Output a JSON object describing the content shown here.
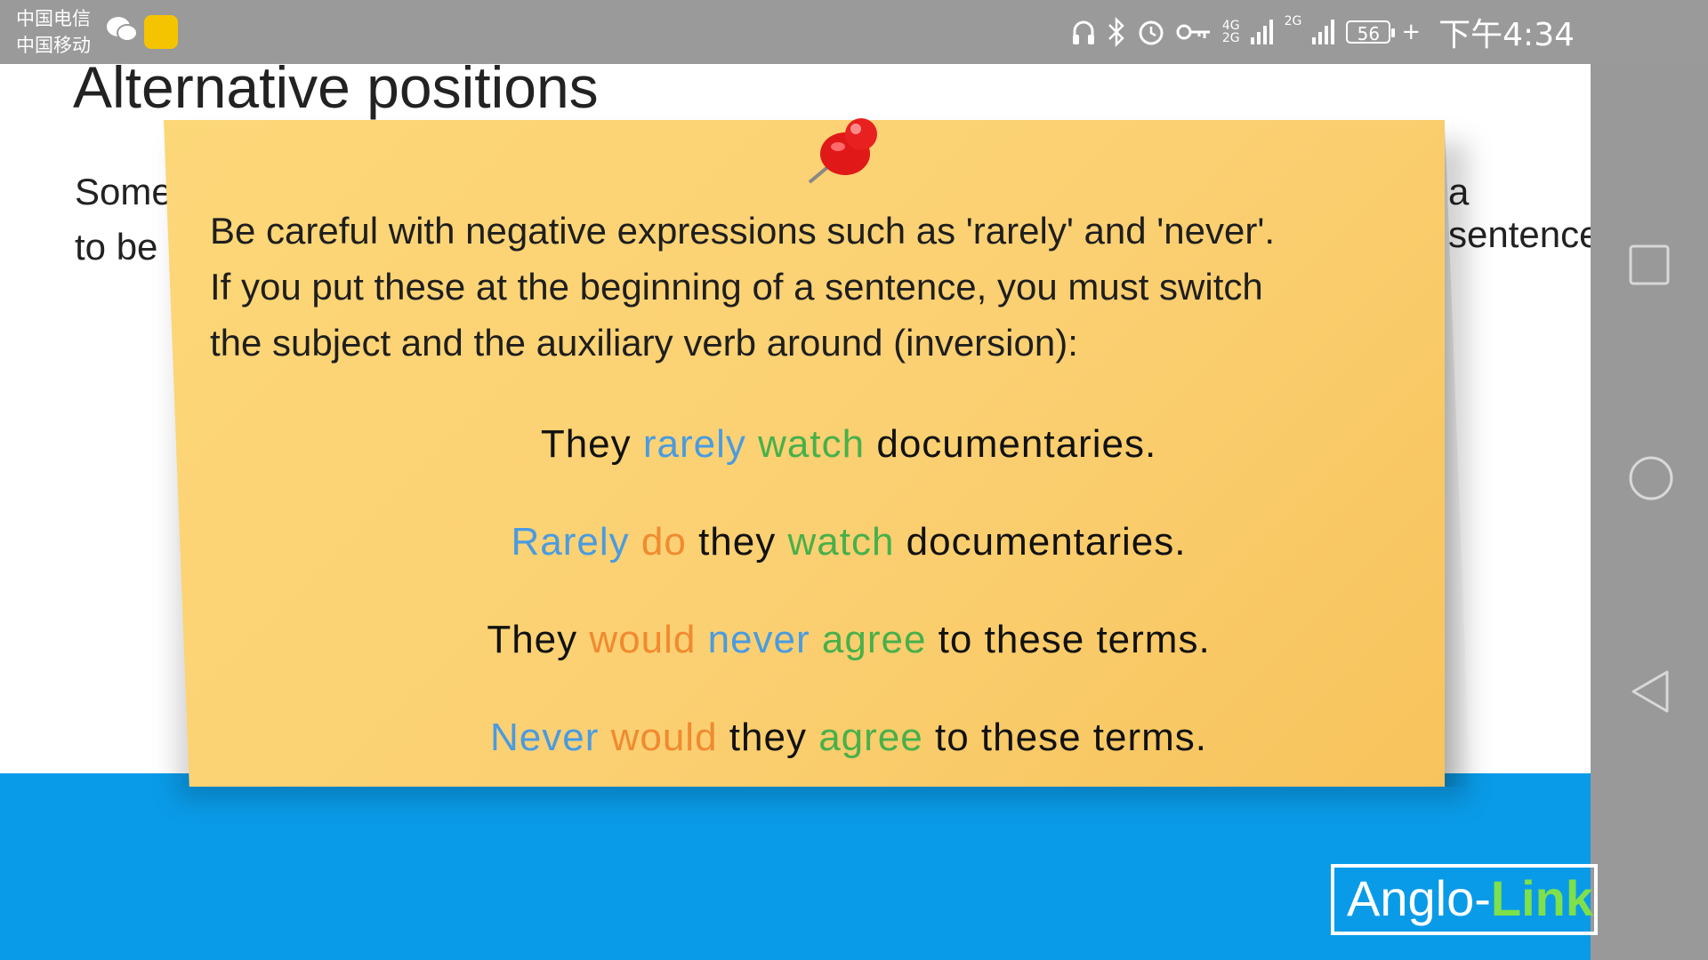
{
  "status_bar": {
    "carrier_1": "中国电信",
    "carrier_2": "中国移动",
    "network_1": "4G",
    "network_2": "2G",
    "network_3": "2G",
    "battery": "56",
    "time": "下午4:34",
    "icons": [
      "wechat-icon",
      "app-icon",
      "headphones-icon",
      "bluetooth-icon",
      "alarm-icon",
      "key-icon",
      "signal-icon",
      "signal-icon",
      "battery-icon",
      "charging-icon"
    ]
  },
  "slide": {
    "title": "Alternative positions",
    "bg_line1_left": "Some",
    "bg_line1_right": "a sentence",
    "bg_line2_left": "to be"
  },
  "note": {
    "line1": "Be careful with negative expressions such as 'rarely' and 'never'.",
    "line2": "If you put these at the beginning of a sentence, you must switch",
    "line3": "the subject and the auxiliary verb around (inversion):",
    "examples": [
      [
        {
          "text": "They",
          "color": "#111111"
        },
        {
          "text": "rarely",
          "color": "#4a9be0"
        },
        {
          "text": "watch",
          "color": "#48b04a"
        },
        {
          "text": "documentaries.",
          "color": "#111111"
        }
      ],
      [
        {
          "text": "Rarely",
          "color": "#4a9be0"
        },
        {
          "text": "do",
          "color": "#f08a30"
        },
        {
          "text": "they",
          "color": "#111111"
        },
        {
          "text": "watch",
          "color": "#48b04a"
        },
        {
          "text": "documentaries.",
          "color": "#111111"
        }
      ],
      [
        {
          "text": "They",
          "color": "#111111"
        },
        {
          "text": "would",
          "color": "#f08a30"
        },
        {
          "text": "never",
          "color": "#4a9be0"
        },
        {
          "text": "agree",
          "color": "#48b04a"
        },
        {
          "text": "to these terms.",
          "color": "#111111"
        }
      ],
      [
        {
          "text": "Never",
          "color": "#4a9be0"
        },
        {
          "text": "would",
          "color": "#f08a30"
        },
        {
          "text": "they",
          "color": "#111111"
        },
        {
          "text": "agree",
          "color": "#48b04a"
        },
        {
          "text": "to these terms.",
          "color": "#111111"
        }
      ]
    ]
  },
  "logo": {
    "part1": "Anglo-",
    "part2": "Link"
  },
  "navbar": {
    "icons": [
      "recent-apps-icon",
      "home-icon",
      "back-icon"
    ]
  }
}
